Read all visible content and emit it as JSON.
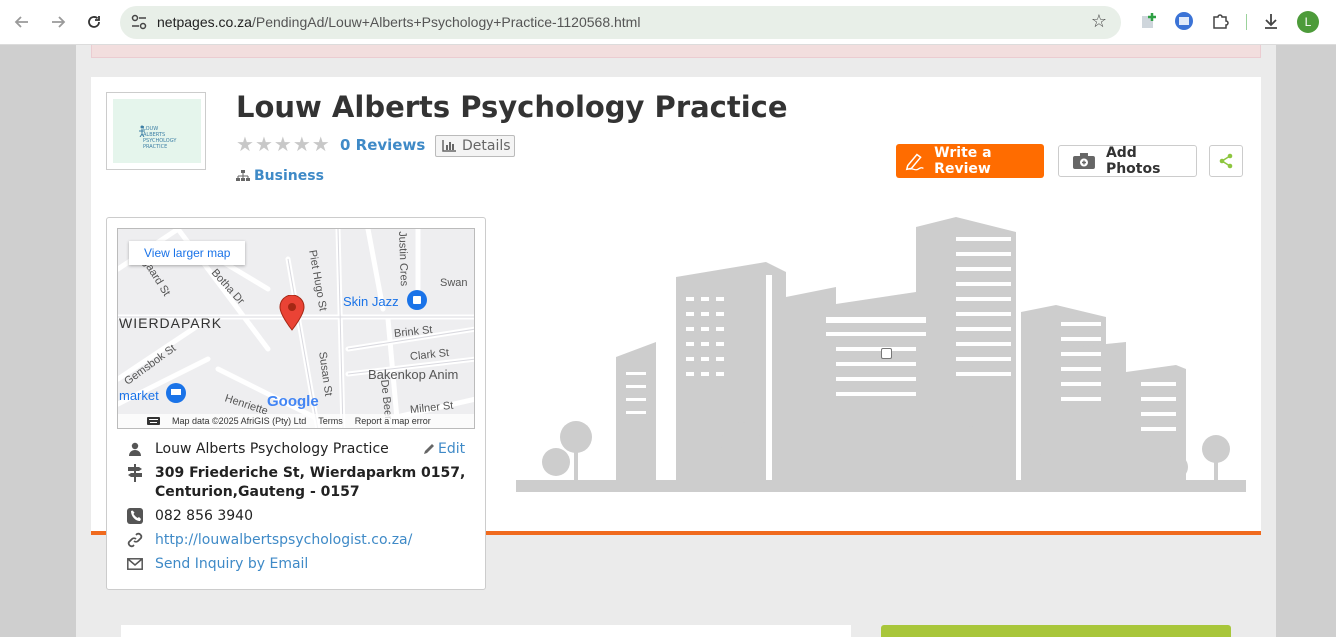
{
  "browser": {
    "url_host": "netpages.co.za",
    "url_path": "/PendingAd/Louw+Alberts+Psychology+Practice-1120568.html",
    "profile_initial": "L"
  },
  "business": {
    "name": "Louw Alberts Psychology Practice",
    "logo_text": "LOUW ALBERTS PSYCHOLOGY PRACTICE",
    "reviews_label": "0 Reviews",
    "rating": 0,
    "max_rating": 5,
    "details_label": "Details",
    "category": "Business"
  },
  "actions": {
    "write_review": "Write a Review",
    "add_photos": "Add Photos"
  },
  "map": {
    "view_larger": "View larger map",
    "labels": {
      "wierdapark": "WIERDAPARK",
      "skin_jazz": "Skin Jazz",
      "hougaard": "Hougaard St",
      "botha": "Botha Dr",
      "piet_hugo": "Piet Hugo St",
      "justin": "Justin Cres",
      "swan": "Swan",
      "brink": "Brink St",
      "clark": "Clark St",
      "bakenkop": "Bakenkop Anim",
      "gemsbok": "Gemsbok St",
      "susan": "Susan St",
      "market": "market",
      "henrietta": "Henriette",
      "de_beer": "De Beer",
      "milner": "Milner St"
    },
    "google": "Google",
    "map_data": "Map data ©2025 AfriGIS (Pty) Ltd",
    "terms": "Terms",
    "report": "Report a map error"
  },
  "contact": {
    "name": "Louw Alberts Psychology Practice",
    "edit": "Edit",
    "address_line1": "309 Friederiche St, Wierdaparkm 0157,",
    "address_line2": "Centurion,Gauteng - 0157",
    "phone": "082 856 3940",
    "website": "http://louwalbertspsychologist.co.za/",
    "inquiry": "Send Inquiry by Email"
  },
  "colors": {
    "accent_orange": "#ff6c00",
    "link_blue": "#3f8ac7",
    "share_green": "#8dc63f"
  }
}
